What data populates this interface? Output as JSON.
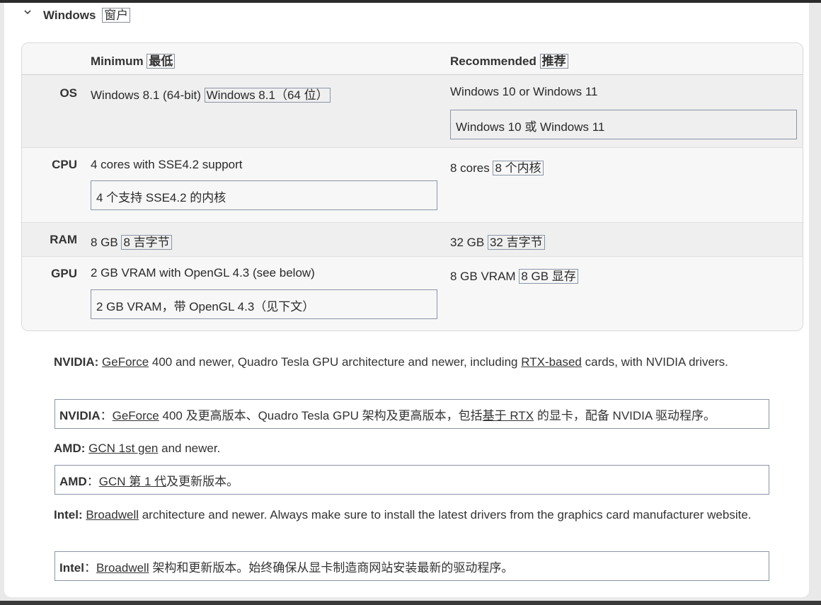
{
  "section": {
    "title": "Windows",
    "title_zh": "窗户"
  },
  "table": {
    "headers": {
      "minimum": "Minimum",
      "minimum_zh": "最低",
      "recommended": "Recommended",
      "recommended_zh": "推荐"
    },
    "rows": [
      {
        "label": "OS",
        "min": "Windows 8.1 (64-bit)",
        "min_zh": "Windows 8.1（64 位）",
        "rec": "Windows 10 or Windows 11",
        "rec_zh": "Windows 10 或 Windows 11"
      },
      {
        "label": "CPU",
        "min": "4 cores with SSE4.2 support",
        "min_zh": "4 个支持 SSE4.2 的内核",
        "rec": "8 cores",
        "rec_zh": "8 个内核"
      },
      {
        "label": "RAM",
        "min": "8 GB",
        "min_zh": "8 吉字节",
        "rec": "32 GB",
        "rec_zh": "32 吉字节"
      },
      {
        "label": "GPU",
        "min": "2 GB VRAM with OpenGL 4.3 (see below)",
        "min_zh": "2 GB VRAM，带 OpenGL 4.3（见下文）",
        "rec": "8 GB VRAM",
        "rec_zh": "8 GB 显存"
      }
    ]
  },
  "notes": {
    "nvidia": {
      "label": "NVIDIA:",
      "link1": "GeForce",
      "text1": " 400 and newer, Quadro Tesla GPU architecture and newer, including ",
      "link2": "RTX-based",
      "text2": " cards, with NVIDIA drivers.",
      "zh_label": "NVIDIA",
      "zh_sep": "：",
      "zh_link1": "GeForce",
      "zh_text1": " 400 及更高版本、Quadro Tesla GPU 架构及更高版本，包括",
      "zh_link2": "基于 RTX",
      "zh_text2": " 的显卡，配备 NVIDIA 驱动程序。"
    },
    "amd": {
      "label": "AMD:",
      "link1": "GCN 1st gen",
      "text1": " and newer.",
      "zh_label": "AMD",
      "zh_sep": "：",
      "zh_link1": "GCN 第 1 代",
      "zh_text1": "及更新版本。"
    },
    "intel": {
      "label": "Intel:",
      "link1": "Broadwell",
      "text1": " architecture and newer. Always make sure to install the latest drivers from the graphics card manufacturer website.",
      "zh_label": "Intel",
      "zh_sep": "：",
      "zh_link1": "Broadwell",
      "zh_text1": " 架构和更新版本。始终确保从显卡制造商网站安装最新的驱动程序。"
    }
  },
  "icons": {
    "collapse": "chevron-down-icon"
  }
}
